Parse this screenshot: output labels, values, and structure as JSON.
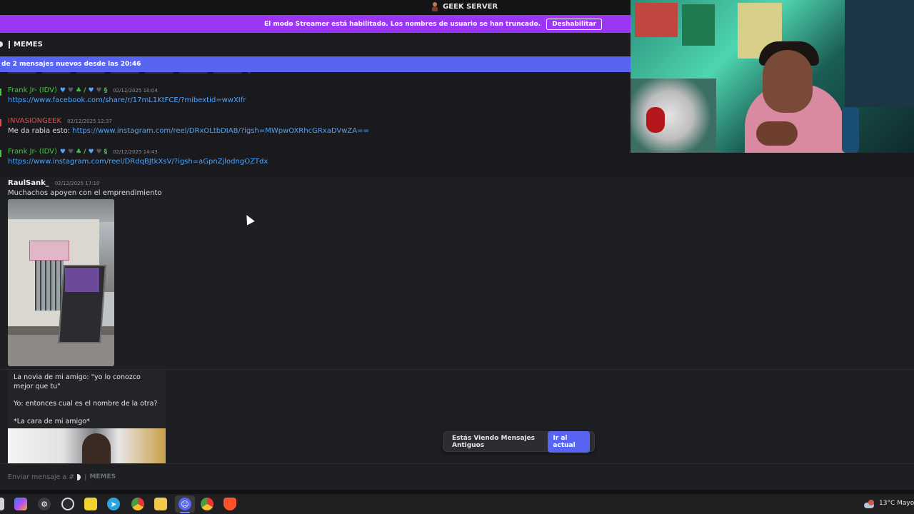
{
  "server": {
    "name": "GEEK SERVER"
  },
  "banner": {
    "text": "El modo Streamer está habilitado. Los nombres de usuario se han truncado.",
    "button_label": "Deshabilitar"
  },
  "channel": {
    "name": "MEMES"
  },
  "new_messages_bar": {
    "text": "de 2 mensajes nuevos desde las 20:46"
  },
  "messages": [
    {
      "author": "Frank Jr- (IDV)",
      "badges": [
        "blue-heart-icon",
        "grey-heart-icon",
        "green-shamrock-icon",
        "slash",
        "blue-heart-icon",
        "grey-heart-icon",
        "snake-icon"
      ],
      "badge_slash": "/",
      "timestamp": "02/12/2025 10:04",
      "link": "https://www.facebook.com/share/r/17mL1KtFCE/?mibextid=wwXIfr"
    },
    {
      "author": "INVASIONGEEK",
      "timestamp": "02/12/2025 12:37",
      "text_prefix": "Me da rabia esto: ",
      "link": "https://www.instagram.com/reel/DRxOLtbDIAB/?igsh=MWpwOXRhcGRxaDVwZA=="
    },
    {
      "author": "Frank Jr- (IDV)",
      "badge_slash": "/",
      "timestamp": "02/12/2025 14:43",
      "link": "https://www.instagram.com/reel/DRdqBJtkXsV/?igsh=aGpnZjlodngOZTdx"
    },
    {
      "author": "RaulSank_",
      "timestamp": "02/12/2025 17:10",
      "text": "Muchachos apoyen con el emprendimiento"
    }
  ],
  "meme_card": {
    "line1": "La novia de mi amigo: \"yo lo conozco mejor que tu\"",
    "line2": "Yo: entonces cual es el nombre de la otra?",
    "line3": "*La cara de mi amigo*"
  },
  "old_messages": {
    "label": "Estás Viendo Mensajes Antiguos",
    "button_label": "Ir al actual"
  },
  "composer": {
    "placeholder_prefix": "Enviar mensaje a #",
    "pipe": "|",
    "channel": "MEMES"
  },
  "taskbar": {
    "apps": [
      "start-icon",
      "copilot-icon",
      "settings-icon",
      "obs-icon",
      "sticky-notes-icon",
      "telegram-icon",
      "chrome-icon",
      "file-explorer-icon",
      "discord-icon",
      "chrome-icon",
      "brave-icon"
    ],
    "weather_temp": "13°C",
    "weather_text": "Mayo"
  },
  "colors": {
    "banner": "#9b36f5",
    "new_bar": "#5865f2",
    "link": "#4fa3f7",
    "green_author": "#43c843",
    "red_author": "#e84a4a"
  }
}
